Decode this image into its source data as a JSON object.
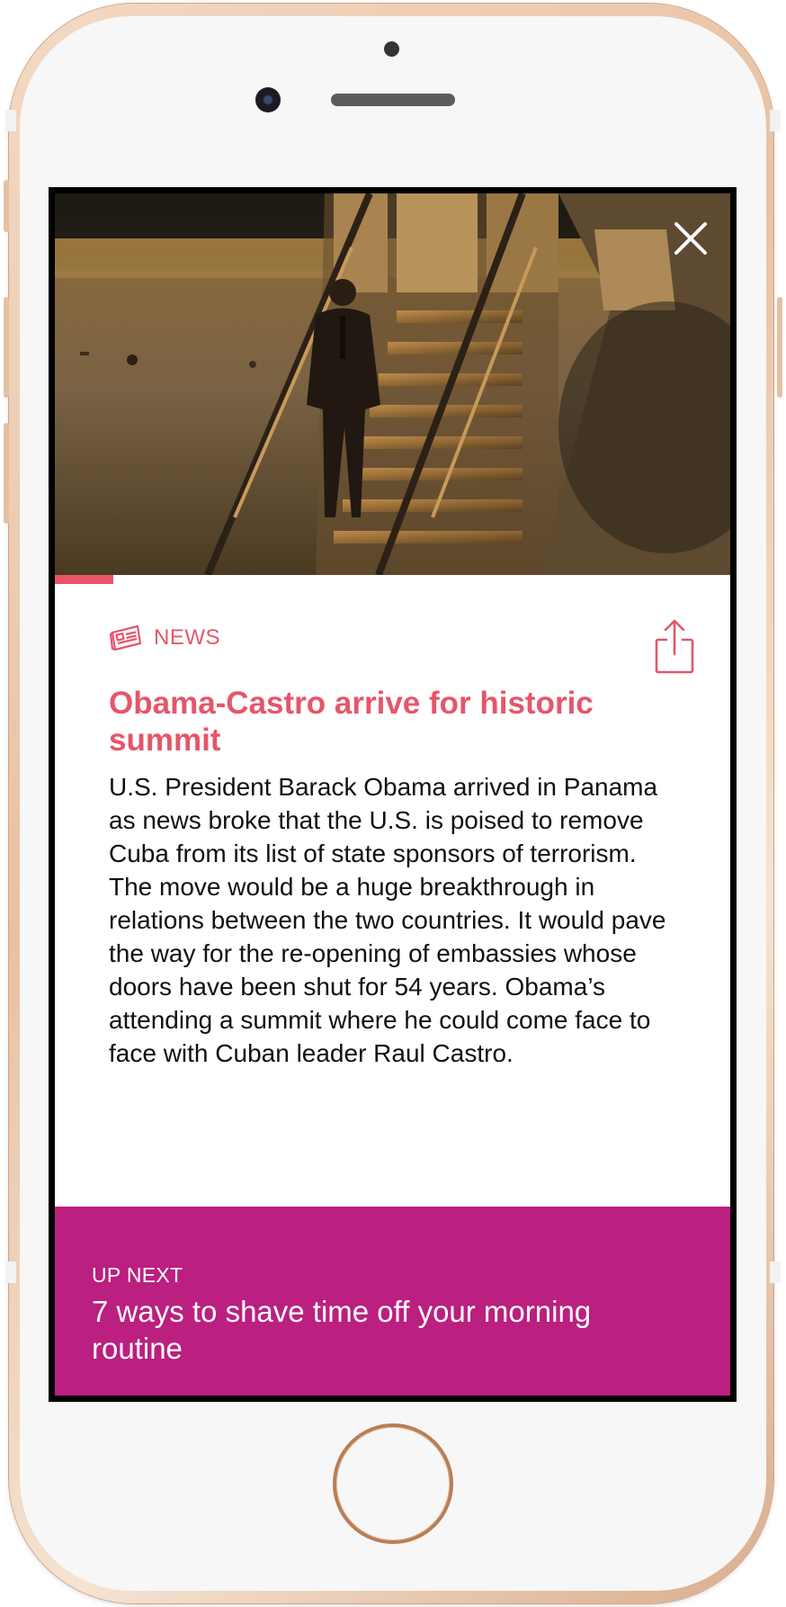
{
  "device": {
    "frame_color": "#e8c2a4",
    "home_button_ring_color": "#b97e55"
  },
  "video": {
    "description_icon": "video-frame-image",
    "progress": 0.087,
    "progress_color": "#e8546a"
  },
  "close": {
    "icon": "close-icon"
  },
  "article": {
    "category_icon": "newspaper-icon",
    "category": "NEWS",
    "accent_color": "#e5566a",
    "share_icon": "share-icon",
    "headline": "Obama-Castro arrive for historic summit",
    "body": "U.S. President Barack Obama arrived in Panama as news broke that the U.S. is poised to remove Cuba from its list of state sponsors of terrorism. The move would be a huge breakthrough in relations between the two countries. It would pave the way for the re-opening of embassies whose doors have been shut for 54 years. Obama’s attending a summit where he could come face to face with Cuban leader Raul Castro."
  },
  "up_next": {
    "label": "UP NEXT",
    "title": "7 ways to shave time off your morning routine",
    "background_color": "#bb1f80"
  }
}
